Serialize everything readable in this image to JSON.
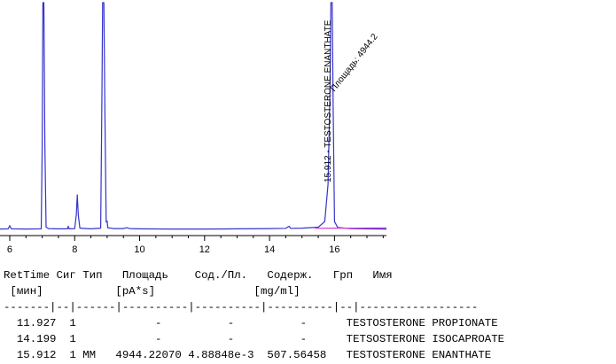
{
  "chart_data": {
    "type": "line",
    "x_range": [
      5.7,
      17.6
    ],
    "y_range": [
      0,
      100
    ],
    "x_ticks": [
      6,
      8,
      10,
      12,
      14,
      16
    ],
    "x_tick_labels": [
      "6",
      "8",
      "10",
      "12",
      "14",
      "16"
    ],
    "baseline": 2.8,
    "series": [
      {
        "color": "#3333cc",
        "points": [
          [
            5.7,
            2.8
          ],
          [
            5.95,
            2.9
          ],
          [
            6.0,
            4.3
          ],
          [
            6.05,
            2.9
          ],
          [
            6.5,
            2.8
          ],
          [
            6.97,
            2.9
          ],
          [
            7.0,
            38
          ],
          [
            7.02,
            100
          ],
          [
            7.05,
            100
          ],
          [
            7.08,
            40
          ],
          [
            7.12,
            3.6
          ],
          [
            7.2,
            3.0
          ],
          [
            7.5,
            2.9
          ],
          [
            7.78,
            2.9
          ],
          [
            7.8,
            4.0
          ],
          [
            7.83,
            2.9
          ],
          [
            8.0,
            3.0
          ],
          [
            8.05,
            9
          ],
          [
            8.08,
            17.5
          ],
          [
            8.11,
            9
          ],
          [
            8.16,
            3.2
          ],
          [
            8.5,
            2.9
          ],
          [
            8.8,
            3.2
          ],
          [
            8.84,
            60
          ],
          [
            8.86,
            100
          ],
          [
            8.9,
            100
          ],
          [
            8.93,
            55
          ],
          [
            8.97,
            5.8
          ],
          [
            9.0,
            6.2
          ],
          [
            9.02,
            3.4
          ],
          [
            9.2,
            3.0
          ],
          [
            9.5,
            3.0
          ],
          [
            9.6,
            3.4
          ],
          [
            9.7,
            3.0
          ],
          [
            10.0,
            2.9
          ],
          [
            11.0,
            2.8
          ],
          [
            12.0,
            2.8
          ],
          [
            13.0,
            2.9
          ],
          [
            14.0,
            3.0
          ],
          [
            14.5,
            3.1
          ],
          [
            14.6,
            4.0
          ],
          [
            14.65,
            3.1
          ],
          [
            15.0,
            3.2
          ],
          [
            15.5,
            3.6
          ],
          [
            15.7,
            6
          ],
          [
            15.8,
            22
          ],
          [
            15.86,
            60
          ],
          [
            15.89,
            100
          ],
          [
            15.93,
            100
          ],
          [
            15.96,
            55
          ],
          [
            16.0,
            6.0
          ],
          [
            16.1,
            3.5
          ],
          [
            16.5,
            3.0
          ],
          [
            17.0,
            2.9
          ],
          [
            17.6,
            2.8
          ]
        ]
      },
      {
        "color": "#d23cd2",
        "points": [
          [
            15.4,
            3.1
          ],
          [
            15.9,
            3.2
          ],
          [
            16.5,
            3.2
          ],
          [
            17.6,
            3.3
          ]
        ]
      }
    ],
    "peak_annotations": [
      {
        "x": 15.912,
        "label": "15.912 - TESTOSTERONE ENANTHATE"
      },
      {
        "x": 16.05,
        "label": "Площадь: 4944.2"
      }
    ]
  },
  "report": {
    "header1": "RetTime Сиг Тип   Площадь    Сод./Пл.   Содерж.   Грп   Имя",
    "header2": " [мин]           [pA*s]               [mg/ml]",
    "separator": "-------|--|------|----------|----------|----------|--|------------------",
    "rows": [
      "  11.927  1            -          -          -      TESTOSTERONE PROPIONATE",
      "  14.199  1            -          -          -      TETSOSTERONE ISOCAPROATE",
      "  15.912  1 MM   4944.22070 4.88848e-3  507.56458   TESTOSTERONE ENANTHATE"
    ]
  }
}
